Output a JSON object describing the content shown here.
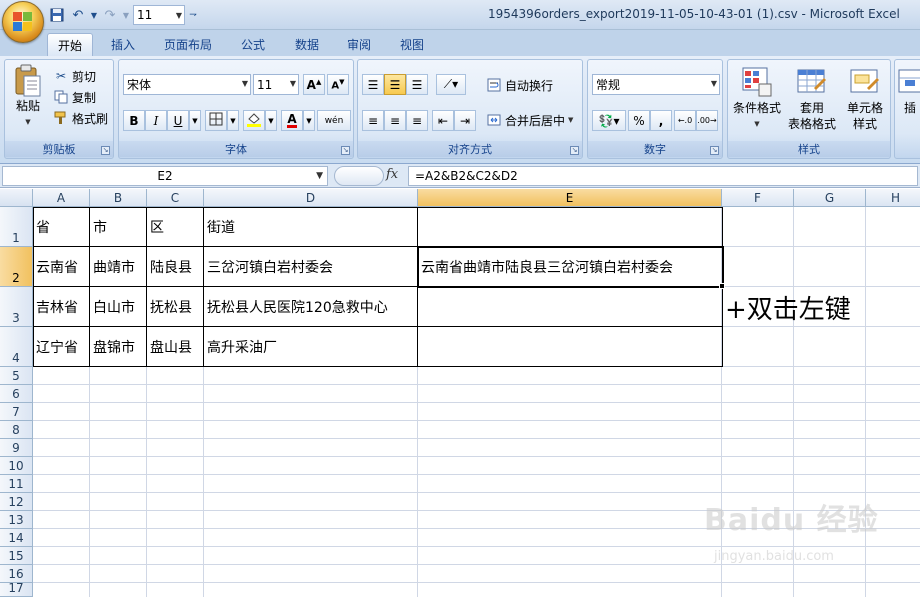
{
  "window": {
    "title": "1954396orders_export2019-11-05-10-43-01 (1).csv - Microsoft Excel"
  },
  "qat": {
    "font_size": "11"
  },
  "tabs": [
    {
      "label": "开始",
      "active": true
    },
    {
      "label": "插入"
    },
    {
      "label": "页面布局"
    },
    {
      "label": "公式"
    },
    {
      "label": "数据"
    },
    {
      "label": "审阅"
    },
    {
      "label": "视图"
    }
  ],
  "ribbon": {
    "clipboard": {
      "label": "剪贴板",
      "paste": "粘贴",
      "cut": "剪切",
      "copy": "复制",
      "format_painter": "格式刷"
    },
    "font": {
      "label": "字体",
      "font_name": "宋体",
      "font_size": "11",
      "bold": "B",
      "italic": "I",
      "underline": "U",
      "phonetic": "wén"
    },
    "alignment": {
      "label": "对齐方式",
      "wrap_text": "自动换行",
      "merge_center": "合并后居中"
    },
    "number": {
      "label": "数字",
      "format": "常规",
      "percent": "%",
      "comma": ","
    },
    "styles": {
      "label": "样式",
      "conditional_formatting": "条件格式",
      "format_as_table_1": "套用",
      "format_as_table_2": "表格格式",
      "cell_styles_1": "单元格",
      "cell_styles_2": "样式",
      "insert": "插"
    }
  },
  "formula_bar": {
    "name_box": "E2",
    "fx": "fx",
    "formula": "=A2&B2&C2&D2"
  },
  "grid": {
    "columns": [
      "A",
      "B",
      "C",
      "D",
      "E",
      "F",
      "G",
      "H"
    ],
    "selected_column": "E",
    "rows": [
      "1",
      "2",
      "3",
      "4",
      "5",
      "6",
      "7",
      "8",
      "9",
      "10",
      "11",
      "12",
      "13",
      "14",
      "15",
      "16",
      "17"
    ],
    "selected_row": "2",
    "header_row": [
      "省",
      "市",
      "区",
      "街道",
      ""
    ],
    "data_rows": [
      [
        "云南省",
        "曲靖市",
        "陆良县",
        "三岔河镇白岩村委会",
        "云南省曲靖市陆良县三岔河镇白岩村委会"
      ],
      [
        "吉林省",
        "白山市",
        "抚松县",
        "抚松县人民医院120急救中心",
        ""
      ],
      [
        "辽宁省",
        "盘锦市",
        "盘山县",
        "高升采油厂",
        ""
      ]
    ]
  },
  "annotation": "+双击左键",
  "watermark": {
    "main": "Baidu 经验",
    "sub": "jingyan.baidu.com"
  }
}
